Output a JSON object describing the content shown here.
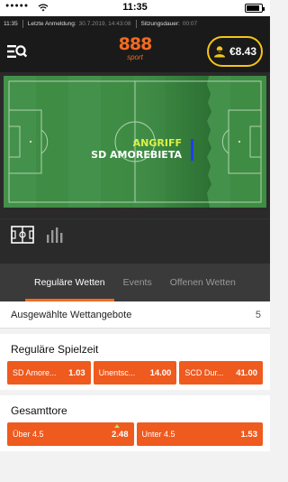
{
  "status_bar": {
    "clock": "11:35",
    "battery_level": 0.85
  },
  "session": {
    "time": "11:35",
    "last_login_label": "Letzte Anmeldung:",
    "last_login_value": "30.7.2019, 14:43:08",
    "session_label": "Sitzungsdauer:",
    "session_value": "00:07"
  },
  "header": {
    "brand": "888",
    "brand_sub": "sport",
    "balance": "€8.43",
    "menu_icon": "menu-search-icon",
    "user_icon": "user-icon",
    "accent": "#f26b21",
    "balance_border": "#f5c518"
  },
  "pitch": {
    "label_top": "ANGRIFF",
    "label_team": "SD AMOREBIETA",
    "team_color": "#1f3cff",
    "label_color": "#d9f244"
  },
  "view_toggle": {
    "icons": [
      "field-icon",
      "stats-icon"
    ]
  },
  "tabs": [
    {
      "label": "Reguläre Wetten",
      "active": true
    },
    {
      "label": "Events",
      "active": false
    },
    {
      "label": "Offenen Wetten",
      "active": false
    }
  ],
  "offers": {
    "label": "Ausgewählte Wettangebote",
    "count": "5"
  },
  "markets": [
    {
      "title": "Reguläre Spielzeit",
      "odds": [
        {
          "label": "SD Amore...",
          "price": "1.03"
        },
        {
          "label": "Unentsc...",
          "price": "14.00"
        },
        {
          "label": "SCD Dur...",
          "price": "41.00"
        }
      ]
    },
    {
      "title": "Gesamttore",
      "odds": [
        {
          "label": "Über 4.5",
          "price": "2.48",
          "trend": "up"
        },
        {
          "label": "Unter 4.5",
          "price": "1.53"
        }
      ]
    }
  ]
}
